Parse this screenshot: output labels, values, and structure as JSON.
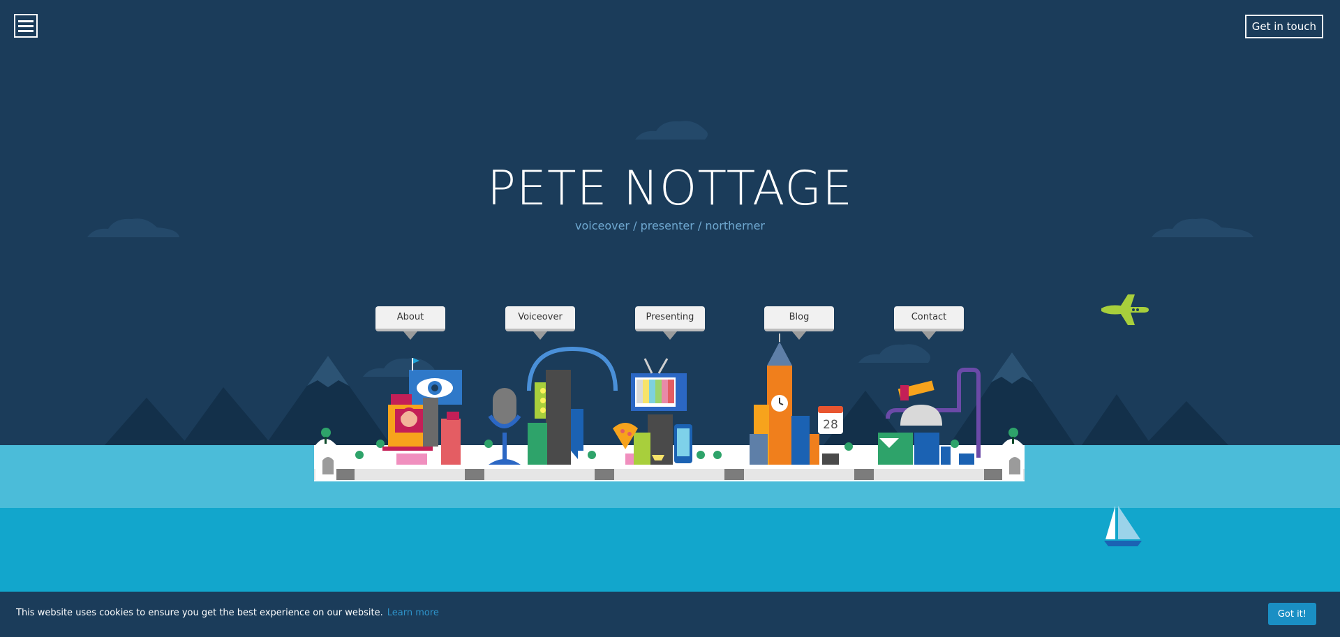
{
  "header": {
    "menu_icon": "hamburger-icon",
    "cta_label": "Get in touch"
  },
  "hero": {
    "title": "PETE NOTTAGE",
    "subtitle": "voiceover / presenter / northerner"
  },
  "nav": {
    "items": [
      {
        "label": "About"
      },
      {
        "label": "Voiceover"
      },
      {
        "label": "Presenting"
      },
      {
        "label": "Blog"
      },
      {
        "label": "Contact"
      }
    ]
  },
  "illustrations": {
    "calendar_day": "28",
    "icons": [
      "eye-billboard-icon",
      "microphone-icon",
      "headphones-icon",
      "tv-icon",
      "pizza-icon",
      "phone-icon",
      "big-ben-icon",
      "calendar-icon",
      "telescope-icon",
      "airplane-icon",
      "sailboat-icon"
    ]
  },
  "colors": {
    "sky": "#1b3c5a",
    "water_light": "#4bbcd9",
    "water_dark": "#12a6cc",
    "accent": "#1a8fc4",
    "subtitle": "#6fa8d0"
  },
  "cookie": {
    "text": "This website uses cookies to ensure you get the best experience on our website.",
    "link_label": "Learn more",
    "button_label": "Got it!"
  }
}
